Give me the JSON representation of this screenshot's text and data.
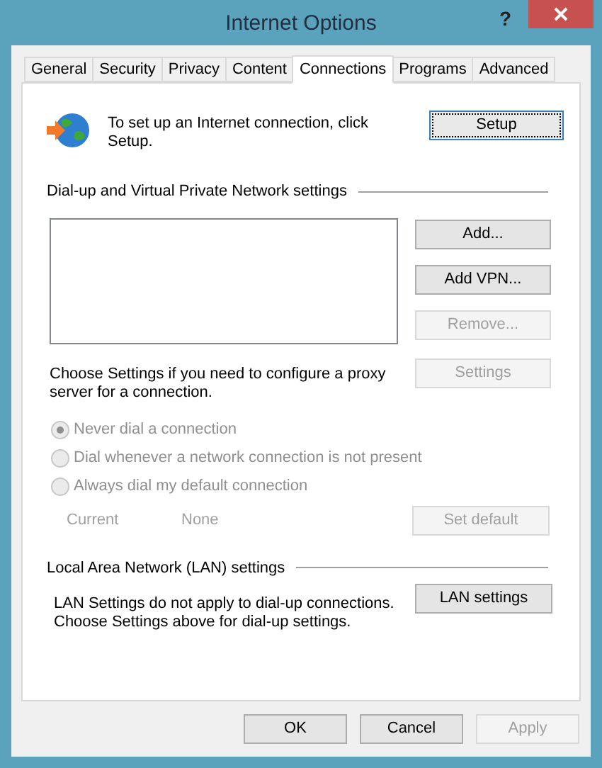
{
  "window": {
    "title": "Internet Options",
    "help": "?"
  },
  "tabs": [
    {
      "label": "General",
      "selected": false
    },
    {
      "label": "Security",
      "selected": false
    },
    {
      "label": "Privacy",
      "selected": false
    },
    {
      "label": "Content",
      "selected": false
    },
    {
      "label": "Connections",
      "selected": true
    },
    {
      "label": "Programs",
      "selected": false
    },
    {
      "label": "Advanced",
      "selected": false
    }
  ],
  "setup": {
    "text": "To set up an Internet connection, click Setup.",
    "button": {
      "label": "Setup",
      "disabled": false,
      "focused": true
    }
  },
  "dialup": {
    "heading": "Dial-up and Virtual Private Network settings",
    "buttons": [
      {
        "label": "Add...",
        "disabled": false
      },
      {
        "label": "Add VPN...",
        "disabled": false
      },
      {
        "label": "Remove...",
        "disabled": true
      }
    ],
    "proxy_text": "Choose Settings if you need to configure a proxy server for a connection.",
    "settings_button": {
      "label": "Settings",
      "disabled": true
    },
    "radios": [
      {
        "label": "Never dial a connection",
        "selected": true,
        "disabled": true
      },
      {
        "label": "Dial whenever a network connection is not present",
        "selected": false,
        "disabled": true
      },
      {
        "label": "Always dial my default connection",
        "selected": false,
        "disabled": true
      }
    ],
    "current_label": "Current",
    "current_value": "None",
    "set_default_button": {
      "label": "Set default",
      "disabled": true
    }
  },
  "lan": {
    "heading": "Local Area Network (LAN) settings",
    "lines": [
      "LAN Settings do not apply to dial-up connections.",
      "Choose Settings above for dial-up settings."
    ],
    "button": {
      "label": "LAN settings",
      "disabled": false
    }
  },
  "footer_buttons": [
    {
      "label": "OK",
      "disabled": false
    },
    {
      "label": "Cancel",
      "disabled": false
    },
    {
      "label": "Apply",
      "disabled": true
    }
  ]
}
